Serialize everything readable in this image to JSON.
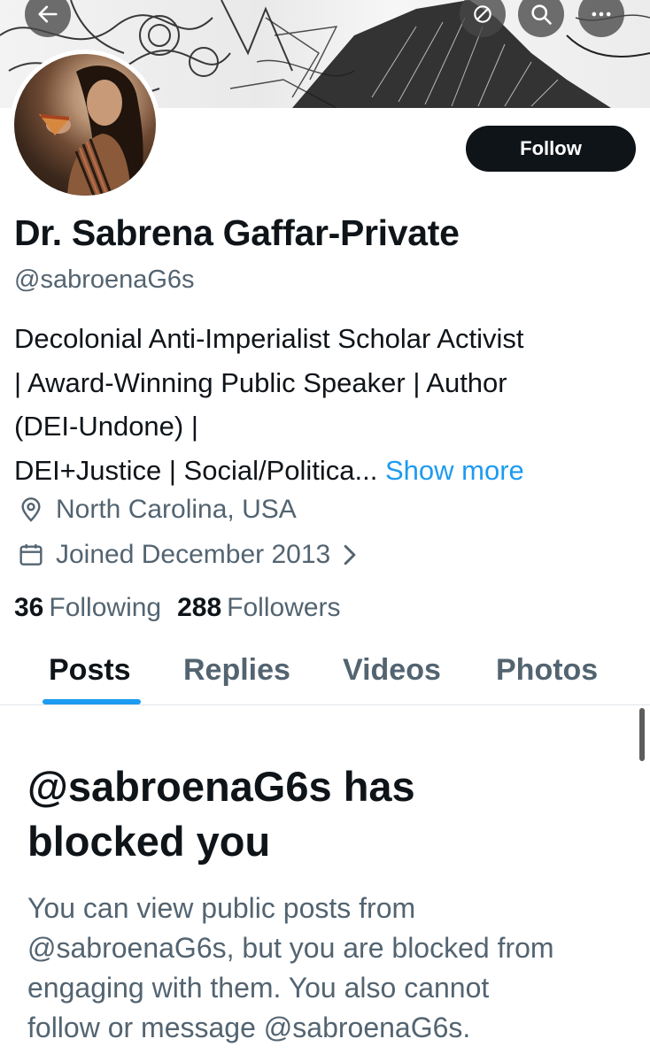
{
  "header": {
    "back_icon": "arrow-left-icon",
    "actions": [
      "edit-icon",
      "search-icon",
      "more-icon"
    ]
  },
  "profile": {
    "display_name": "Dr. Sabrena Gaffar-Private",
    "handle": "@sabroenaG6s",
    "follow_label": "Follow",
    "bio_lines": [
      "Decolonial Anti-Imperialist Scholar Activist",
      "| Award-Winning Public Speaker | Author",
      "(DEI-Undone) |",
      "DEI+Justice | Social/Politica..."
    ],
    "show_more": "Show more",
    "location": "North Carolina, USA",
    "joined": "Joined December 2013",
    "following_count": "36",
    "following_label": "Following",
    "followers_count": "288",
    "followers_label": "Followers"
  },
  "tabs": [
    {
      "label": "Posts",
      "active": true
    },
    {
      "label": "Replies",
      "active": false
    },
    {
      "label": "Videos",
      "active": false
    },
    {
      "label": "Photos",
      "active": false
    }
  ],
  "blocked": {
    "title_lines": [
      "@sabroenaG6s has",
      "blocked you"
    ],
    "body_lines": [
      "You can view public posts from",
      "@sabroenaG6s, but you are blocked from",
      "engaging with them. You also cannot",
      "follow or message @sabroenaG6s."
    ]
  },
  "colors": {
    "accent": "#1d9bf0",
    "text_primary": "#0f1419",
    "text_secondary": "#536471",
    "button_dark": "#0f1419"
  }
}
